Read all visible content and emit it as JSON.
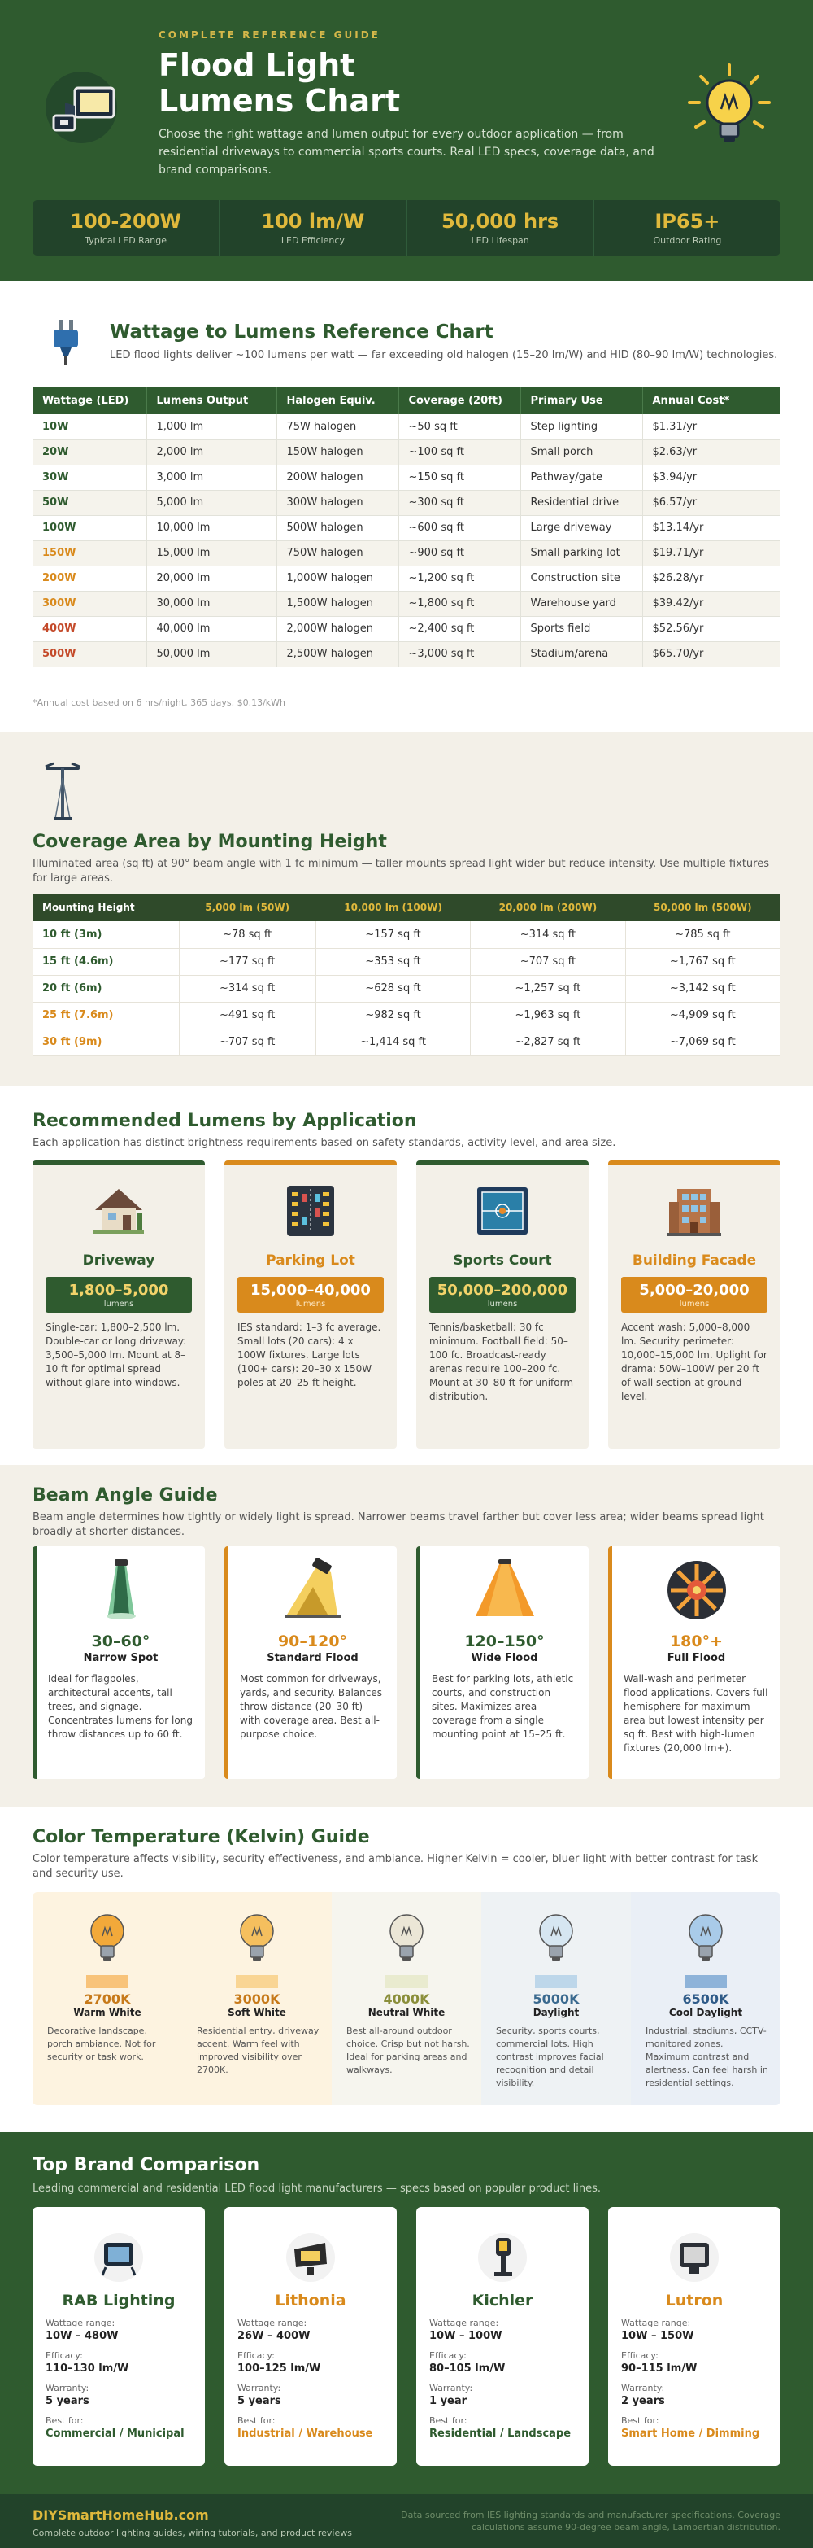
{
  "hero": {
    "kicker": "COMPLETE REFERENCE GUIDE",
    "title": "Flood Light Lumens Chart",
    "subtitle": "Choose the right wattage and lumen output for every outdoor application — from residential driveways to commercial sports courts. Real LED specs, coverage data, and brand comparisons.",
    "stats": [
      {
        "value": "100-200W",
        "label": "Typical LED Range"
      },
      {
        "value": "100 lm/W",
        "label": "LED Efficiency"
      },
      {
        "value": "50,000 hrs",
        "label": "LED Lifespan"
      },
      {
        "value": "IP65+",
        "label": "Outdoor Rating"
      }
    ]
  },
  "wattage": {
    "title": "Wattage to Lumens Reference Chart",
    "desc": "LED flood lights deliver ~100 lumens per watt — far exceeding old halogen (15–20 lm/W) and HID (80–90 lm/W) technologies.",
    "headers": [
      "Wattage (LED)",
      "Lumens Output",
      "Halogen Equiv.",
      "Coverage (20ft)",
      "Primary Use",
      "Annual Cost*"
    ],
    "rows": [
      [
        "10W",
        "1,000 lm",
        "75W halogen",
        "~50 sq ft",
        "Step lighting",
        "$1.31/yr"
      ],
      [
        "20W",
        "2,000 lm",
        "150W halogen",
        "~100 sq ft",
        "Small porch",
        "$2.63/yr"
      ],
      [
        "30W",
        "3,000 lm",
        "200W halogen",
        "~150 sq ft",
        "Pathway/gate",
        "$3.94/yr"
      ],
      [
        "50W",
        "5,000 lm",
        "300W halogen",
        "~300 sq ft",
        "Residential drive",
        "$6.57/yr"
      ],
      [
        "100W",
        "10,000 lm",
        "500W halogen",
        "~600 sq ft",
        "Large driveway",
        "$13.14/yr"
      ],
      [
        "150W",
        "15,000 lm",
        "750W halogen",
        "~900 sq ft",
        "Small parking lot",
        "$19.71/yr"
      ],
      [
        "200W",
        "20,000 lm",
        "1,000W halogen",
        "~1,200 sq ft",
        "Construction site",
        "$26.28/yr"
      ],
      [
        "300W",
        "30,000 lm",
        "1,500W halogen",
        "~1,800 sq ft",
        "Warehouse yard",
        "$39.42/yr"
      ],
      [
        "400W",
        "40,000 lm",
        "2,000W halogen",
        "~2,400 sq ft",
        "Sports field",
        "$52.56/yr"
      ],
      [
        "500W",
        "50,000 lm",
        "2,500W halogen",
        "~3,000 sq ft",
        "Stadium/arena",
        "$65.70/yr"
      ]
    ],
    "note": "*Annual cost based on 6 hrs/night, 365 days, $0.13/kWh"
  },
  "coverage": {
    "title": "Coverage Area by Mounting Height",
    "desc": "Illuminated area (sq ft) at 90° beam angle with 1 fc minimum — taller mounts spread light wider but reduce intensity. Use multiple fixtures for large areas.",
    "headers": [
      "Mounting Height",
      "5,000 lm (50W)",
      "10,000 lm (100W)",
      "20,000 lm (200W)",
      "50,000 lm (500W)"
    ],
    "rows": [
      [
        "10 ft (3m)",
        "~78 sq ft",
        "~157 sq ft",
        "~314 sq ft",
        "~785 sq ft"
      ],
      [
        "15 ft (4.6m)",
        "~177 sq ft",
        "~353 sq ft",
        "~707 sq ft",
        "~1,767 sq ft"
      ],
      [
        "20 ft (6m)",
        "~314 sq ft",
        "~628 sq ft",
        "~1,257 sq ft",
        "~3,142 sq ft"
      ],
      [
        "25 ft (7.6m)",
        "~491 sq ft",
        "~982 sq ft",
        "~1,963 sq ft",
        "~4,909 sq ft"
      ],
      [
        "30 ft (9m)",
        "~707 sq ft",
        "~1,414 sq ft",
        "~2,827 sq ft",
        "~7,069 sq ft"
      ]
    ]
  },
  "applications": {
    "title": "Recommended Lumens by Application",
    "desc": "Each application has distinct brightness requirements based on safety standards, activity level, and area size.",
    "unit": "lumens",
    "cards": [
      {
        "name": "Driveway",
        "lumens": "1,800–5,000",
        "desc": "Single-car: 1,800–2,500 lm. Double-car or long driveway: 3,500–5,000 lm. Mount at 8–10 ft for optimal spread without glare into windows."
      },
      {
        "name": "Parking Lot",
        "lumens": "15,000–40,000",
        "desc": "IES standard: 1–3 fc average. Small lots (20 cars): 4 x 100W fixtures. Large lots (100+ cars): 20–30 x 150W poles at 20–25 ft height."
      },
      {
        "name": "Sports Court",
        "lumens": "50,000–200,000",
        "desc": "Tennis/basketball: 30 fc minimum. Football field: 50–100 fc. Broadcast-ready arenas require 100–200 fc. Mount at 30–80 ft for uniform distribution."
      },
      {
        "name": "Building Facade",
        "lumens": "5,000–20,000",
        "desc": "Accent wash: 5,000–8,000 lm. Security perimeter: 10,000–15,000 lm. Uplight for drama: 50W–100W per 20 ft of wall section at ground level."
      }
    ]
  },
  "beam": {
    "title": "Beam Angle Guide",
    "desc": "Beam angle determines how tightly or widely light is spread. Narrower beams travel farther but cover less area; wider beams spread light broadly at shorter distances.",
    "cards": [
      {
        "deg": "30–60°",
        "name": "Narrow Spot",
        "desc": "Ideal for flagpoles, architectural accents, tall trees, and signage. Concentrates lumens for long throw distances up to 60 ft."
      },
      {
        "deg": "90–120°",
        "name": "Standard Flood",
        "desc": "Most common for driveways, yards, and security. Balances throw distance (20–30 ft) with coverage area. Best all-purpose choice."
      },
      {
        "deg": "120–150°",
        "name": "Wide Flood",
        "desc": "Best for parking lots, athletic courts, and construction sites. Maximizes area coverage from a single mounting point at 15–25 ft."
      },
      {
        "deg": "180°+",
        "name": "Full Flood",
        "desc": "Wall-wash and perimeter flood applications. Covers full hemisphere for maximum area but lowest intensity per sq ft. Best with high-lumen fixtures (20,000 lm+)."
      }
    ]
  },
  "kelvin": {
    "title": "Color Temperature (Kelvin) Guide",
    "desc": "Color temperature affects visibility, security effectiveness, and ambiance. Higher Kelvin = cooler, bluer light with better contrast for task and security use.",
    "items": [
      {
        "k": "2700K",
        "name": "Warm White",
        "desc": "Decorative landscape, porch ambiance. Not for security or task work.",
        "bg": "#fdf3e0",
        "bulb": "#f2a93a",
        "swatch": "#f8c37a",
        "color": "#c77a1a"
      },
      {
        "k": "3000K",
        "name": "Soft White",
        "desc": "Residential entry, driveway accent. Warm feel with improved visibility over 2700K.",
        "bg": "#fdf3e0",
        "bulb": "#f5bf5e",
        "swatch": "#f9d594",
        "color": "#c77a1a"
      },
      {
        "k": "4000K",
        "name": "Neutral White",
        "desc": "Best all-around outdoor choice. Crisp but not harsh. Ideal for parking areas and walkways.",
        "bg": "#f6f5ee",
        "bulb": "#ebe6d6",
        "swatch": "#e9ebcf",
        "color": "#8b8f3b"
      },
      {
        "k": "5000K",
        "name": "Daylight",
        "desc": "Security, sports courts, commercial lots. High contrast improves facial recognition and detail visibility.",
        "bg": "#eef2f4",
        "bulb": "#d6e6f1",
        "swatch": "#bdd7ea",
        "color": "#3a6a8f"
      },
      {
        "k": "6500K",
        "name": "Cool Daylight",
        "desc": "Industrial, stadiums, CCTV-monitored zones. Maximum contrast and alertness. Can feel harsh in residential settings.",
        "bg": "#eaeff6",
        "bulb": "#a9cbe9",
        "swatch": "#8eb3d9",
        "color": "#2f5b88"
      }
    ]
  },
  "brands": {
    "title": "Top Brand Comparison",
    "desc": "Leading commercial and residential LED flood light manufacturers — specs based on popular product lines.",
    "labels": {
      "wattage": "Wattage range:",
      "efficacy": "Efficacy:",
      "warranty": "Warranty:",
      "best": "Best for:"
    },
    "items": [
      {
        "name": "RAB Lighting",
        "wattage": "10W – 480W",
        "efficacy": "110–130 lm/W",
        "warranty": "5 years",
        "best": "Commercial / Municipal"
      },
      {
        "name": "Lithonia",
        "wattage": "26W – 400W",
        "efficacy": "100–125 lm/W",
        "warranty": "5 years",
        "best": "Industrial / Warehouse"
      },
      {
        "name": "Kichler",
        "wattage": "10W – 100W",
        "efficacy": "80–105 lm/W",
        "warranty": "1 year",
        "best": "Residential / Landscape"
      },
      {
        "name": "Lutron",
        "wattage": "10W – 150W",
        "efficacy": "90–115 lm/W",
        "warranty": "2 years",
        "best": "Smart Home / Dimming"
      }
    ]
  },
  "footer": {
    "site": "DIYSmartHomeHub.com",
    "tagline": "Complete outdoor lighting guides, wiring tutorials, and product reviews",
    "source": "Data sourced from IES lighting standards and manufacturer specifications. Coverage calculations assume 90-degree beam angle, Lambertian distribution."
  }
}
